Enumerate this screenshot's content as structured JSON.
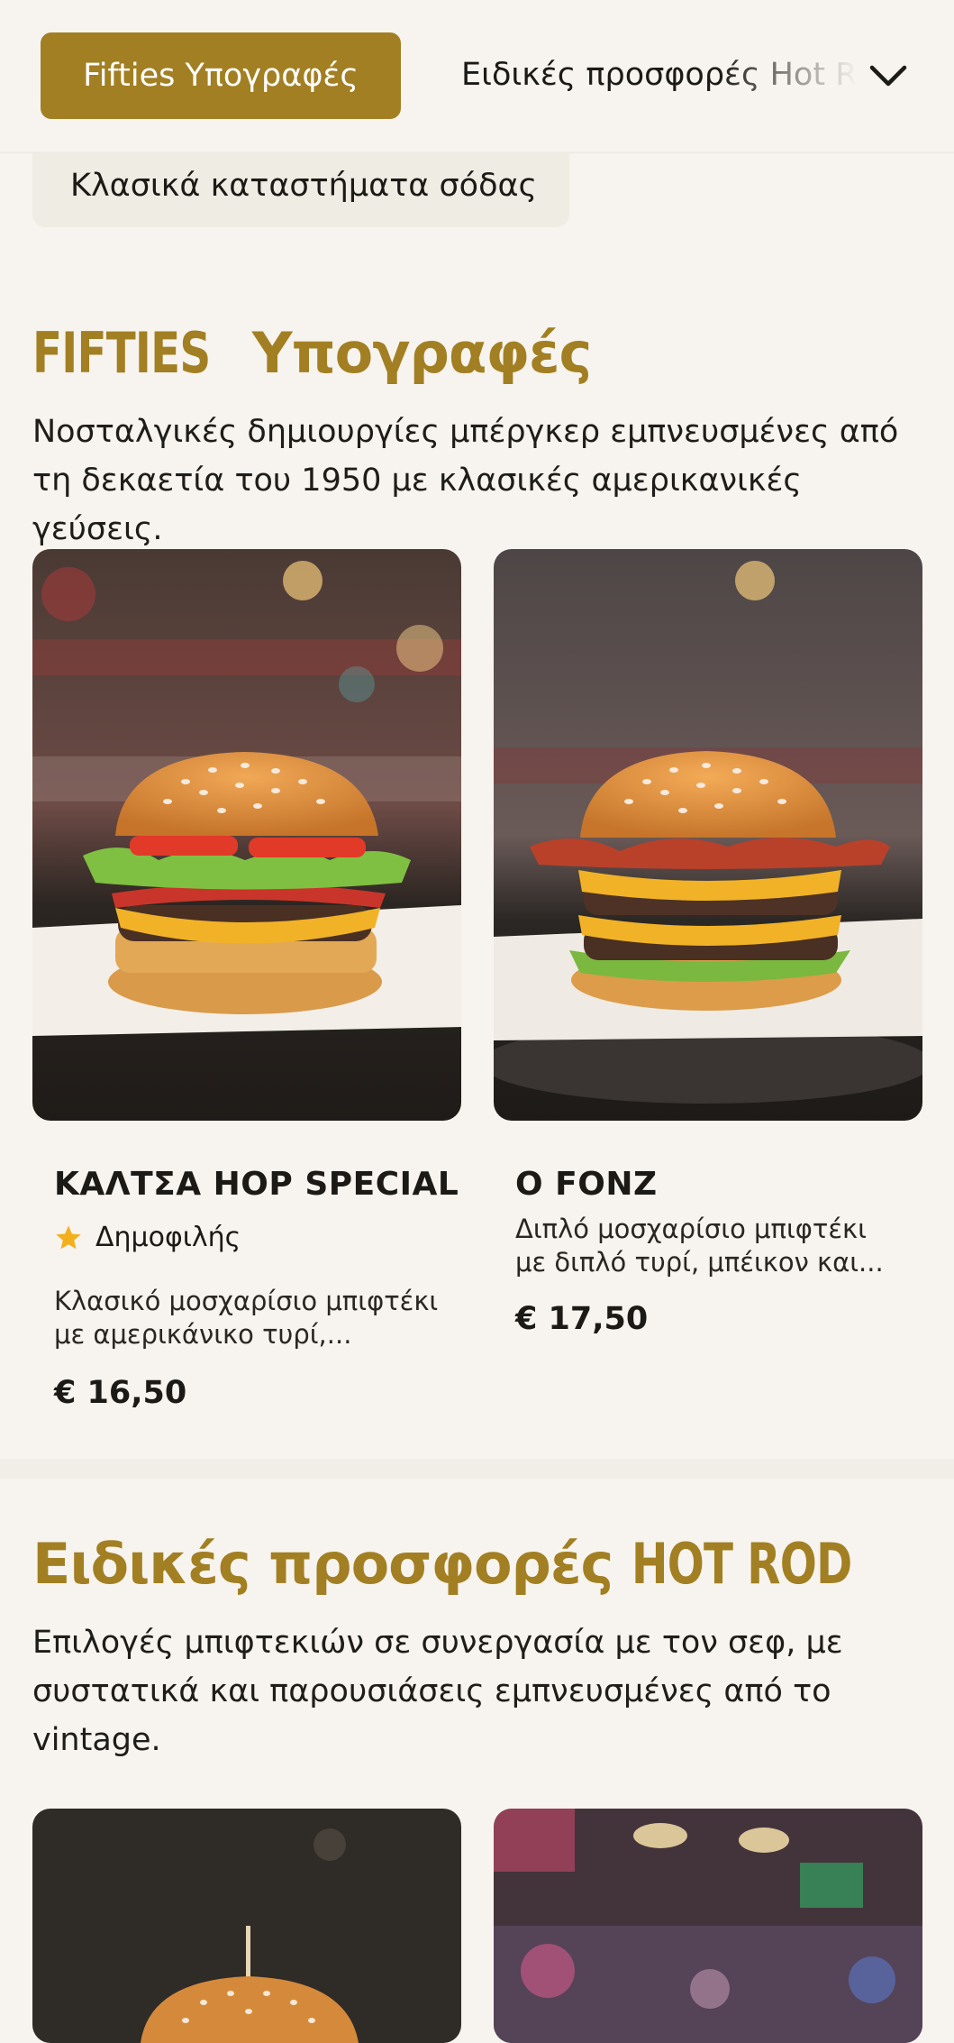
{
  "nav": {
    "active_category": "Fifties Υπογραφές",
    "next_category": "Ειδικές προσφορές Hot Rod",
    "dropdown_item": "Κλασικά καταστήματα σόδας"
  },
  "sections": [
    {
      "title_cond": "FIFTIES",
      "title_rest": "Υπογραφές",
      "description": "Νοσταλγικές δημιουργίες μπέργκερ εμπνευσμένες από τη δεκαετία του 1950 με κλασικές αμερικανικές γεύσεις.",
      "items": [
        {
          "name": "ΚΑΛΤΣΑ HOP SPECIAL",
          "badge": "Δημοφιλής",
          "description": "Κλασικό μοσχαρίσιο μπιφτέκι με αμερικάνικο τυρί,...",
          "price": "€ 16,50"
        },
        {
          "name": "Ο FONZ",
          "description": "Διπλό μοσχαρίσιο μπιφτέκι με διπλό τυρί, μπέικον και...",
          "price": "€ 17,50"
        }
      ]
    },
    {
      "title_rest": "Ειδικές προσφορές",
      "title_cond": "HOT ROD",
      "description": "Επιλογές μπιφτεκιών σε συνεργασία με τον σεφ, με συστατικά και παρουσιάσεις εμπνευσμένες από το vintage."
    }
  ],
  "colors": {
    "accent": "#a27f22",
    "background": "#f7f4ef",
    "star": "#f2b01e"
  }
}
